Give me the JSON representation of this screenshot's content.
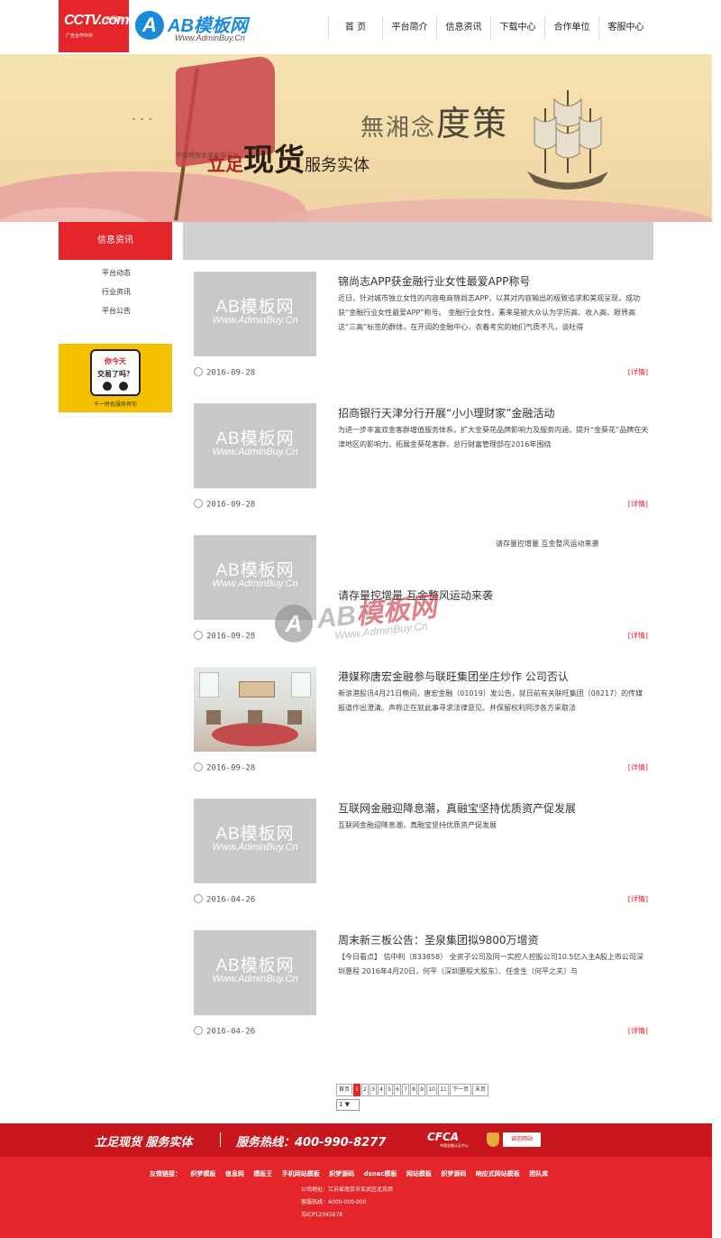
{
  "header": {
    "cctv_logo": {
      "big": "CCTV.com",
      "tag": "央视网",
      "sub": "广告合作伙伴"
    },
    "ab_logo": {
      "letter": "A",
      "title": "AB模板网",
      "url": "Www.AdminBuy.Cn"
    },
    "nav": [
      "首 页",
      "平台简介",
      "信息资讯",
      "下载中心",
      "合作单位",
      "客服中心"
    ]
  },
  "banner": {
    "slogan_a": "立足",
    "slogan_b": "现货",
    "slogan_c": "服务实体",
    "sub": "中南稀有金属交易平台",
    "calligraphy_small": "無湘念",
    "calligraphy_big": "度策"
  },
  "sidebar": {
    "title": "信息资讯",
    "links": [
      "平台动态",
      "行业资讯",
      "平台公告"
    ],
    "ad": {
      "line1": "你今天",
      "line2": "交易了吗？",
      "caption": "千一特色服务有你"
    }
  },
  "articles": [
    {
      "title": "锦尚志APP获金融行业女性最爱APP称号",
      "desc": "近日，针对城市独立女性的内容电商锦尚志APP，以其对内容输出的极致追求和美观呈现，成功获“金融行业女性最爱APP”称号。 金融行业女性，素来是被大众认为学历高、收入高、眼界高这“三高”标签的群体，在开阔的金融中心，衣着考究的她们气质不凡，谈吐得",
      "date": "2016-09-28",
      "more": "[详情]",
      "thumb": {
        "line1": "AB模板网",
        "line2": "Www.AdminBuy.Cn"
      }
    },
    {
      "title": "招商银行天津分行开展“小小理财家”金融活动",
      "desc": "为进一步丰富双金客群增值服务体系，扩大金葵花品牌影响力及服务内涵，提升“金葵花”品牌在天津地区的影响力，拓展金葵花客群，总行财富管理部在2016年围绕",
      "date": "2016-09-28",
      "more": "[详情]",
      "thumb": {
        "line1": "AB模板网",
        "line2": "Www.AdminBuy.Cn"
      }
    },
    {
      "title": "请存量控增量 互金整风运动来袭",
      "desc": "请存量控增量 互金整风运动来袭",
      "date": "2016-09-28",
      "more": "[详情]",
      "thumb": {
        "line1": "AB模板网",
        "line2": "Www.AdminBuy.Cn"
      }
    },
    {
      "title": "港媒称唐宏金融参与联旺集团坐庄炒作 公司否认",
      "desc": "新浪港股讯4月21日晚间，唐宏金融（01019）发公告，就日前有关联旺集团（08217）的传媒报道作出澄清。声称正在就此事寻求法律意见，并保留权利同涉各方采取法",
      "date": "2016-09-28",
      "more": "[详情]"
    },
    {
      "title": "互联网金融迎降息潮，真融宝坚持优质资产促发展",
      "desc": "互联网金融迎降息潮，真融宝坚持优质资产促发展",
      "date": "2016-04-26",
      "more": "[详情]",
      "thumb": {
        "line1": "AB模板网",
        "line2": "Www.AdminBuy.Cn"
      }
    },
    {
      "title": "周末新三板公告：圣泉集团拟9800万增资",
      "desc": "【今日看点】 信中利（833858） 全资子公司及同一实控人控股公司10.5亿入主A股上市公司深圳惠程 2016年4月20日，何平（深圳惠程大股东）、任金生（何平之夫）与",
      "date": "2016-04-26",
      "more": "[详情]",
      "thumb": {
        "line1": "AB模板网",
        "line2": "Www.AdminBuy.Cn"
      }
    }
  ],
  "watermark": {
    "letter": "A",
    "title_a": "AB",
    "title_b": "模板网",
    "url": "Www.AdminBuy.Cn"
  },
  "pager": {
    "first": "首页",
    "pages": [
      "1",
      "2",
      "3",
      "4",
      "5",
      "6",
      "7",
      "8",
      "9",
      "10",
      "11"
    ],
    "next": "下一页",
    "last": "末页",
    "select_value": "1 ▼"
  },
  "footer": {
    "slogan": "立足现货 服务实体",
    "hotline": "服务热线：400-990-8277",
    "cfca": "CFCA",
    "cfca_sub": "中国金融认证中心",
    "badge": "诚信网站",
    "links": [
      "友情链接：",
      "织梦模板",
      "信息网",
      "模板王",
      "手机网站模板",
      "织梦源码",
      "dsoac模板",
      "网站模板",
      "织梦源码",
      "响应式网站模板",
      "团队库"
    ],
    "address": "公司地址：江苏省南京市玄武区北京西",
    "phone": "客服热线：4000-000-000",
    "icp": "苏ICP12345678"
  },
  "colors": {
    "brand_red": "#e4262b",
    "dark_red": "#c8161d",
    "grey_bar": "#cfcfcf",
    "placeholder": "#c8c8c8"
  }
}
